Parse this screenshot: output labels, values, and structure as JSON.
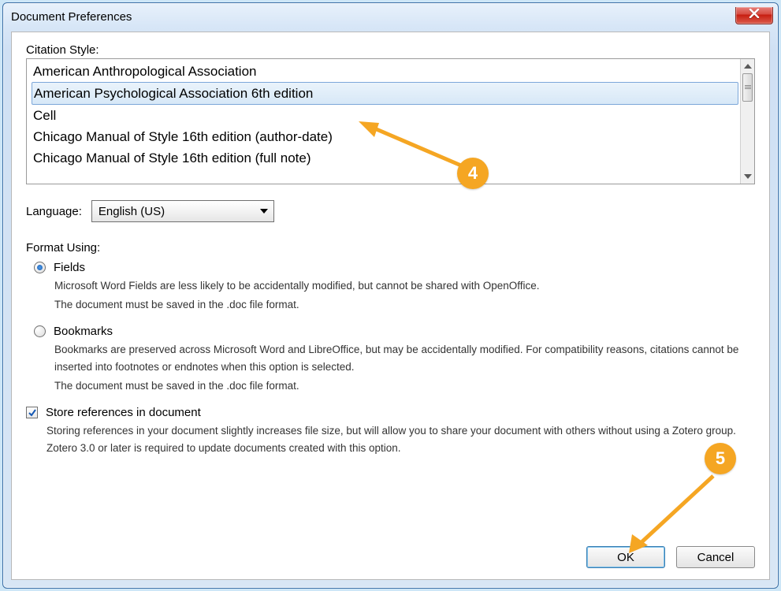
{
  "window": {
    "title": "Document Preferences"
  },
  "citation": {
    "label": "Citation Style:",
    "items": [
      "American Anthropological Association",
      "American Psychological Association 6th edition",
      "Cell",
      "Chicago Manual of Style 16th edition (author-date)",
      "Chicago Manual of Style 16th edition (full note)"
    ],
    "selected_index": 1
  },
  "language": {
    "label": "Language:",
    "value": "English (US)"
  },
  "format": {
    "label": "Format Using:",
    "fields": {
      "label": "Fields",
      "desc1": "Microsoft Word Fields are less likely to be accidentally modified, but cannot be shared with OpenOffice.",
      "desc2": "The document must be saved in the .doc file format."
    },
    "bookmarks": {
      "label": "Bookmarks",
      "desc1": "Bookmarks are preserved across Microsoft Word and LibreOffice, but may be accidentally modified. For compatibility reasons, citations cannot be inserted into footnotes or endnotes when this option is selected.",
      "desc2": "The document must be saved in the .doc file format."
    },
    "selected": "fields"
  },
  "store": {
    "label": "Store references in document",
    "checked": true,
    "desc": "Storing references in your document slightly increases file size, but will allow you to share your document with others without using a Zotero group. Zotero 3.0 or later is required to update documents created with this option."
  },
  "buttons": {
    "ok": "OK",
    "cancel": "Cancel"
  },
  "annotations": {
    "step4": "4",
    "step5": "5"
  }
}
